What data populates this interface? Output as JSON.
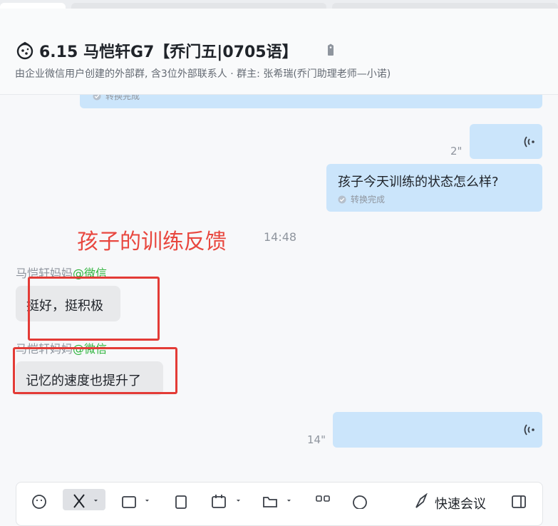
{
  "header": {
    "title": "6.15 马恺轩G7【乔门五|0705语】",
    "subtitle": "由企业微信用户创建的外部群, 含3位外部联系人 · 群主: 张希瑞(乔门助理老师—小诺)"
  },
  "messages": {
    "partial_status": "转换完成",
    "voice1_duration": "2\"",
    "text_message": "孩子今天训练的状态怎么样?",
    "text_status": "转换完成",
    "annotation": "孩子的训练反馈",
    "time": "14:48",
    "sender_name": "马恺轩妈妈",
    "sender_suffix": "@微信",
    "reply1": "挺好，挺积极",
    "reply2": "记忆的速度也提升了",
    "voice2_duration": "14\""
  },
  "composer": {
    "quick_meeting": "快速会议"
  },
  "colors": {
    "bubble_out": "#cbe5fb",
    "bubble_in": "#e8e9eb",
    "annotation_red": "#e33b36",
    "wechat_green": "#2db33b"
  }
}
